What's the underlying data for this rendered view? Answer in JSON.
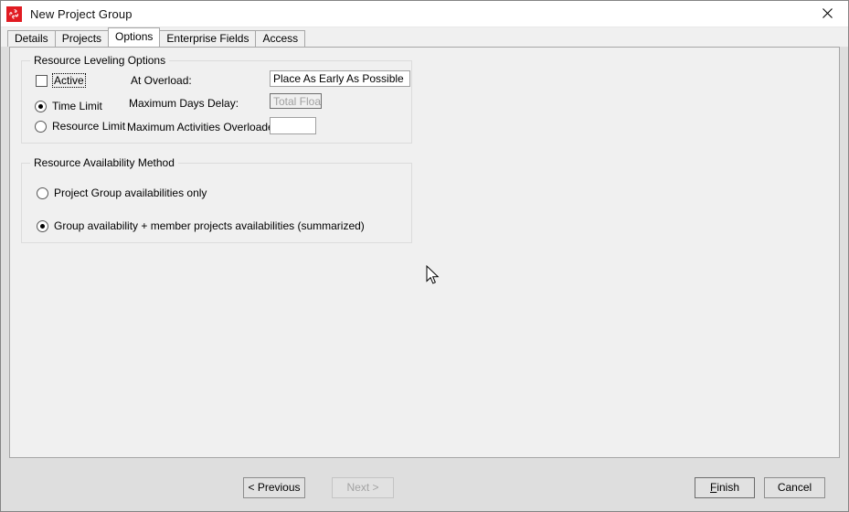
{
  "window": {
    "title": "New Project Group",
    "icon": "app-logo-icon",
    "close_label": "✕",
    "accent": "#e11b22"
  },
  "tabs": [
    {
      "label": "Details",
      "active": false
    },
    {
      "label": "Projects",
      "active": false
    },
    {
      "label": "Options",
      "active": true
    },
    {
      "label": "Enterprise Fields",
      "active": false
    },
    {
      "label": "Access",
      "active": false
    }
  ],
  "leveling": {
    "legend": "Resource Leveling Options",
    "active_checkbox": {
      "label": "Active",
      "checked": false,
      "focused": true
    },
    "limit_radios": [
      {
        "label": "Time Limit",
        "checked": true
      },
      {
        "label": "Resource Limit",
        "checked": false
      }
    ],
    "fields": [
      {
        "label": "At Overload:",
        "value": "Place As Early As Possible",
        "disabled": false
      },
      {
        "label": "Maximum Days Delay:",
        "value": "Total Float",
        "disabled": true
      },
      {
        "label": "Maximum Activities Overloaded:",
        "value": "",
        "disabled": false
      }
    ]
  },
  "availability": {
    "legend": "Resource Availability Method",
    "options": [
      {
        "label": "Project Group availabilities only",
        "checked": false
      },
      {
        "label": "Group availability + member projects availabilities (summarized)",
        "checked": true
      }
    ]
  },
  "buttons": {
    "previous": {
      "label": "< Previous",
      "disabled": false
    },
    "next": {
      "label": "Next >",
      "disabled": true
    },
    "finish": {
      "label": "Finish",
      "mnemonic": "F",
      "rest": "inish",
      "default": true
    },
    "cancel": {
      "label": "Cancel",
      "disabled": false
    }
  }
}
